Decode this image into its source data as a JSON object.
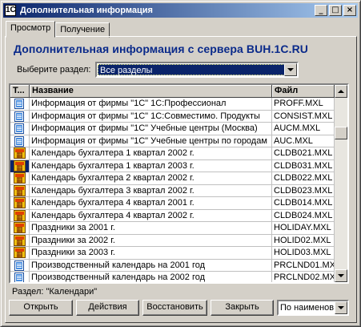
{
  "window": {
    "title": "Дополнительная информация",
    "app_icon": "1C",
    "min_glyph": "_",
    "max_glyph": "□",
    "close_glyph": "×"
  },
  "tabs": [
    {
      "label": "Просмотр",
      "active": true
    },
    {
      "label": "Получение",
      "active": false
    }
  ],
  "heading": "Дополнительная информация с сервера BUH.1C.RU",
  "section": {
    "label": "Выберите раздел:",
    "value": "Все разделы"
  },
  "grid": {
    "columns": [
      "Т...",
      "Название",
      "Файл"
    ],
    "rows": [
      {
        "icon": "document-icon",
        "name": "Информация от фирмы \"1С\" 1С:Профессионал",
        "file": "PROFF.MXL"
      },
      {
        "icon": "document-icon",
        "name": "Информация от фирмы \"1С\"  1С:Совместимо. Продукты",
        "file": "CONSIST.MXL"
      },
      {
        "icon": "document-icon",
        "name": "Информация от фирмы \"1С\" Учебные центры (Москва)",
        "file": "AUCM.MXL"
      },
      {
        "icon": "document-icon",
        "name": "Информация от фирмы \"1С\" Учебные центры по городам",
        "file": "AUC.MXL"
      },
      {
        "icon": "calendar-icon",
        "name": "Календарь бухгалтера  1 квартал 2002 г.",
        "file": "CLDB021.MXL"
      },
      {
        "icon": "calendar-icon",
        "name": "Календарь бухгалтера  1 квартал 2003 г.",
        "file": "CLDB031.MXL",
        "selected": true
      },
      {
        "icon": "calendar-icon",
        "name": "Календарь бухгалтера  2 квартал 2002 г.",
        "file": "CLDB022.MXL"
      },
      {
        "icon": "calendar-icon",
        "name": "Календарь бухгалтера  3 квартал 2002 г.",
        "file": "CLDB023.MXL"
      },
      {
        "icon": "calendar-icon",
        "name": "Календарь бухгалтера  4 квартал 2001 г.",
        "file": "CLDB014.MXL"
      },
      {
        "icon": "calendar-icon",
        "name": "Календарь бухгалтера  4 квартал 2002 г.",
        "file": "CLDB024.MXL"
      },
      {
        "icon": "calendar-icon",
        "name": "Праздники  за 2001 г.",
        "file": "HOLIDAY.MXL"
      },
      {
        "icon": "calendar-icon",
        "name": "Праздники  за 2002 г.",
        "file": "HOLID02.MXL"
      },
      {
        "icon": "calendar-icon",
        "name": "Праздники  за 2003 г.",
        "file": "HOLID03.MXL"
      },
      {
        "icon": "document-icon",
        "name": "Производственный календарь  на 2001 год",
        "file": "PRCLND01.MX"
      },
      {
        "icon": "document-icon",
        "name": "Производственный календарь  на 2002 год",
        "file": "PRCLND02.MX"
      }
    ]
  },
  "status": "Раздел: \"Календари\"",
  "buttons": {
    "open": "Открыть",
    "actions": "Действия",
    "restore": "Восстановить",
    "close": "Закрыть"
  },
  "sort": {
    "value": "По наименов"
  }
}
